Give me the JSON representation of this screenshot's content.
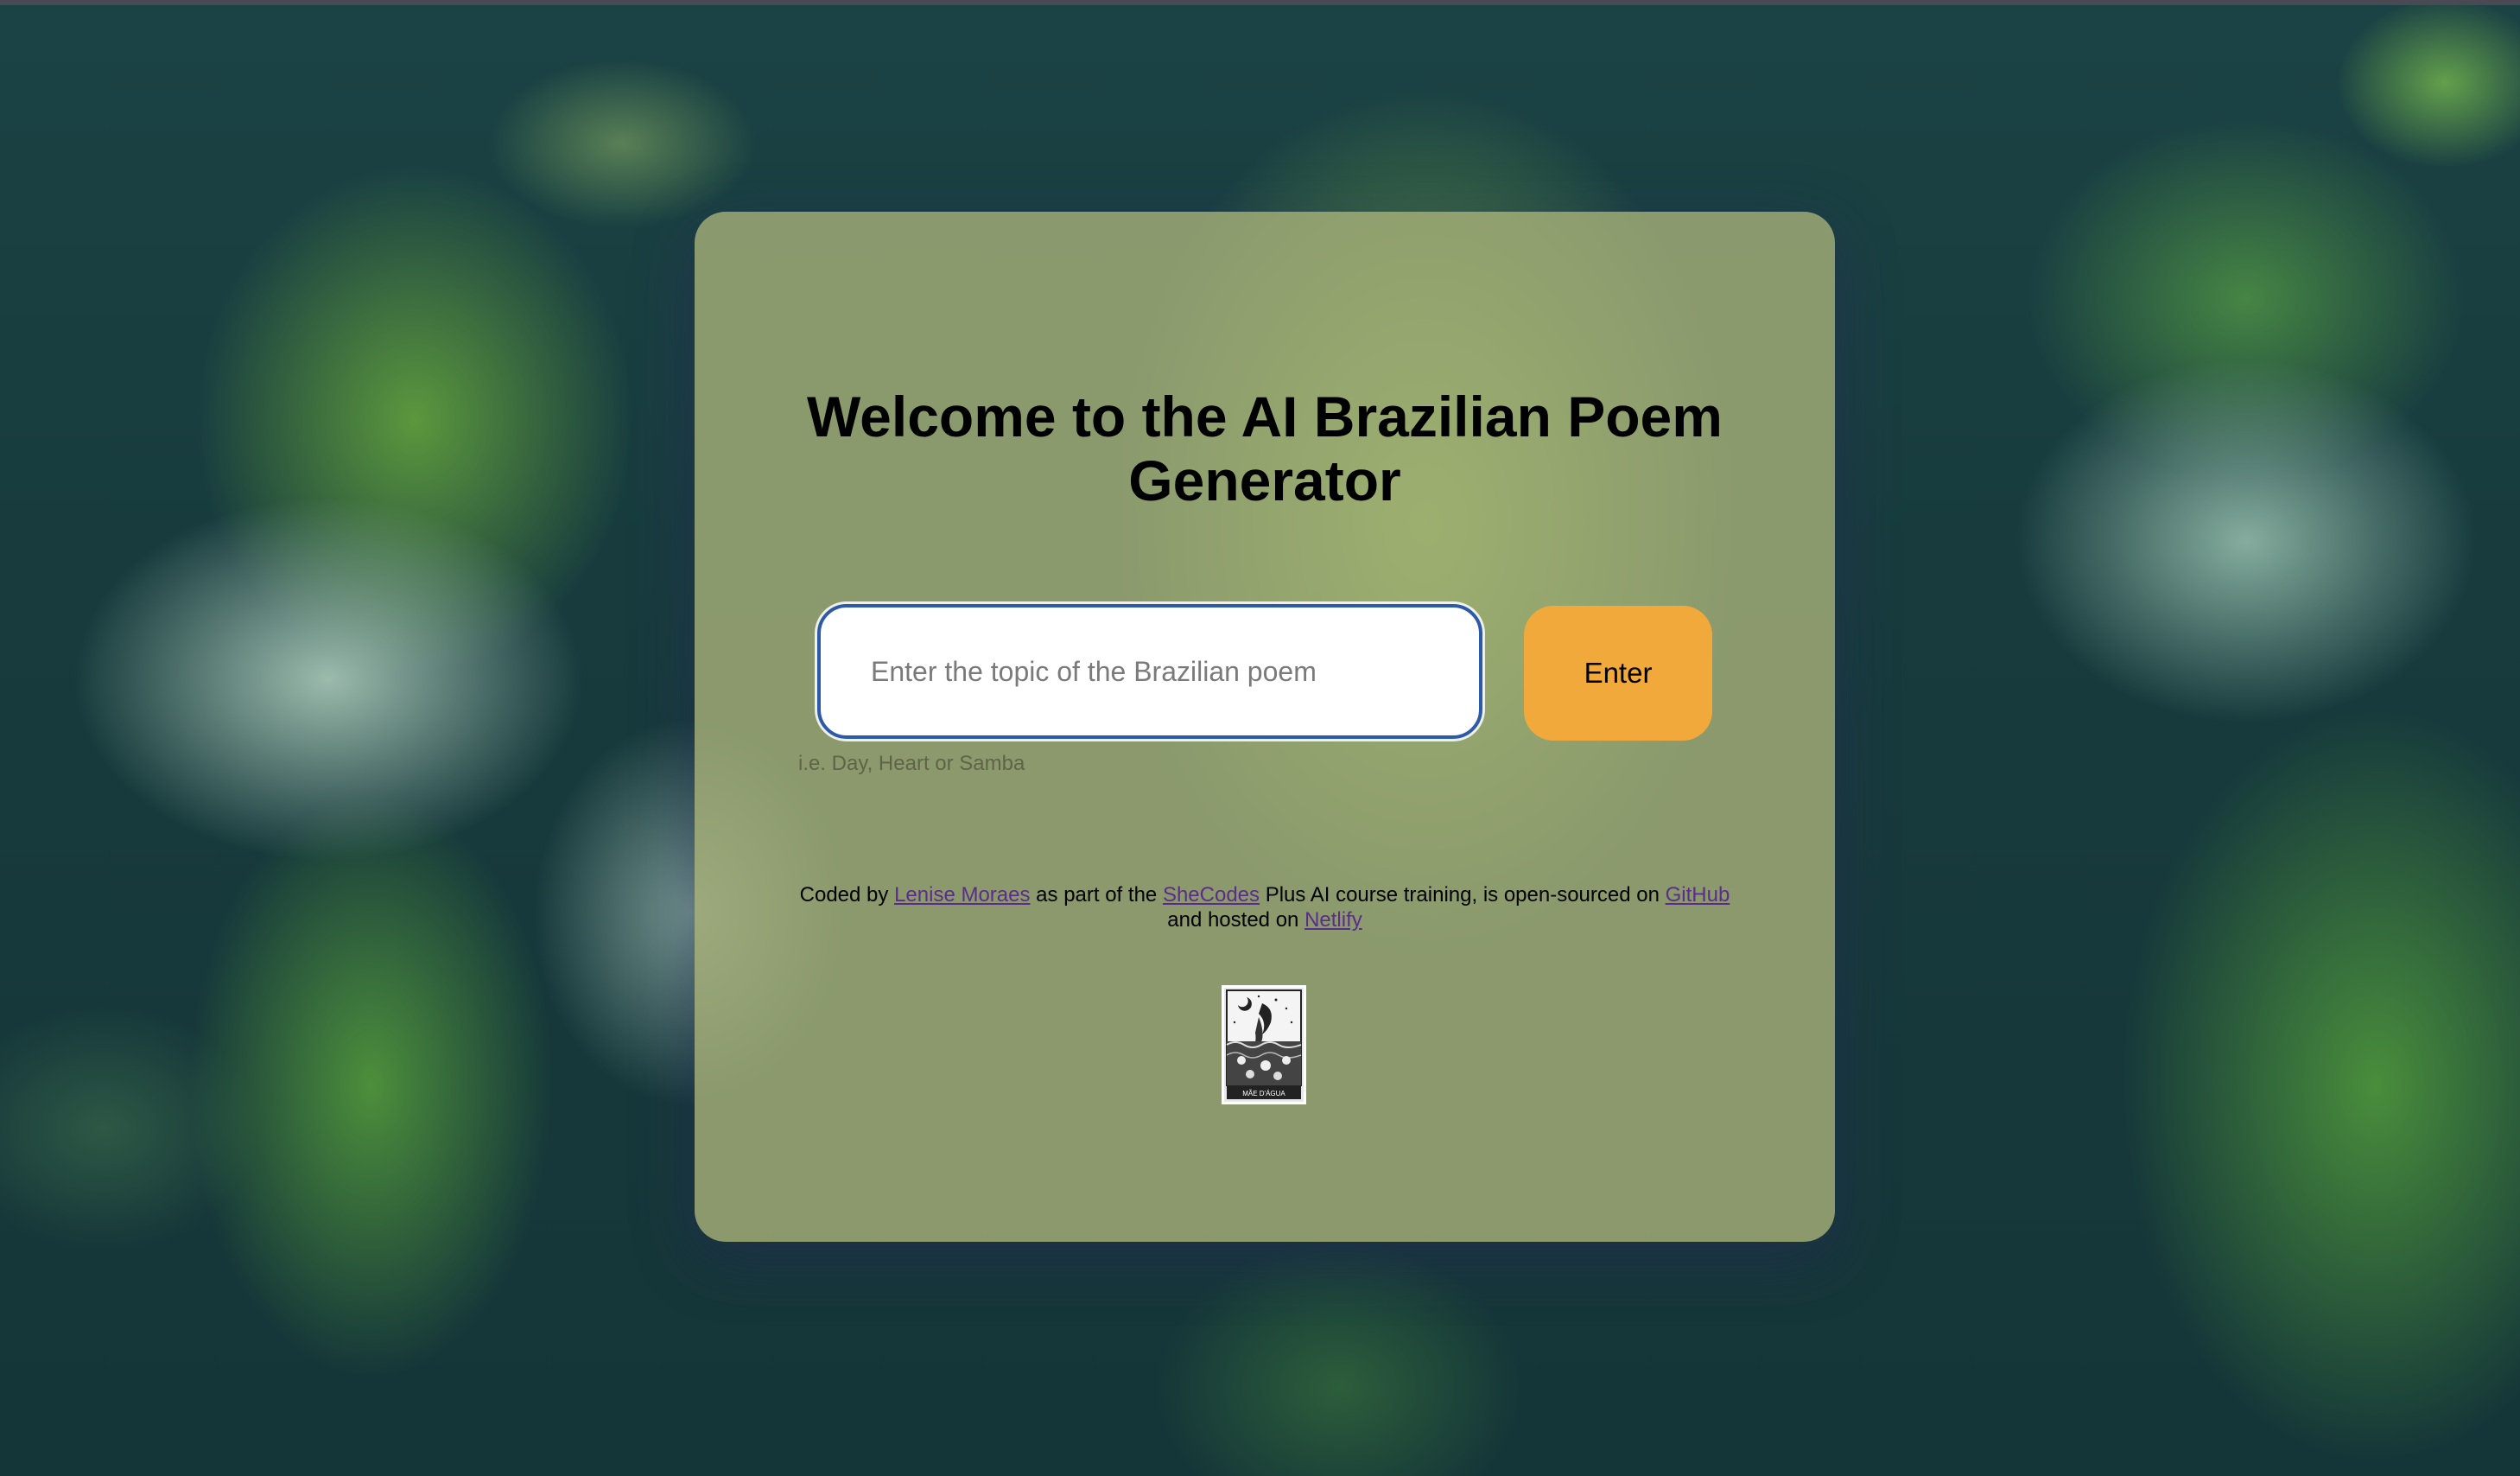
{
  "page": {
    "title": "Welcome to the AI Brazilian Poem Generator"
  },
  "form": {
    "input_placeholder": "Enter the topic of the Brazilian poem",
    "input_value": "",
    "button_label": "Enter",
    "hint": "i.e. Day, Heart or Samba"
  },
  "footer": {
    "coded_by": "Coded by",
    "author_link": "Lenise Moraes",
    "part_of": "as part of the",
    "shecodes_link": "SheCodes",
    "course_text": "Plus AI course training, is open-sourced on",
    "github_link": "GitHub",
    "hosted_text": "and hosted on",
    "netlify_link": "Netlify"
  },
  "poster": {
    "caption": "MÃE D'ÁGUA"
  },
  "colors": {
    "card": "#a5af78",
    "button": "#f2a93b",
    "input_border": "#2d5aa8",
    "link": "#5a2d8c"
  }
}
